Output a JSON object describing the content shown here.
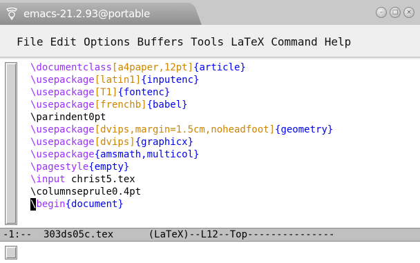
{
  "window": {
    "title": "emacs-21.2.93@portable",
    "buttons": [
      {
        "name": "minimize",
        "glyph": "–"
      },
      {
        "name": "maximize",
        "glyph": "□"
      },
      {
        "name": "close",
        "glyph": "×"
      }
    ]
  },
  "menu": {
    "items": [
      "File",
      "Edit",
      "Options",
      "Buffers",
      "Tools",
      "LaTeX",
      "Command",
      "Help"
    ]
  },
  "colors": {
    "keyword": "#9b30ff",
    "option": "#cd8500",
    "argument": "#0000ee"
  },
  "editor": {
    "lines": [
      [
        {
          "t": "\\documentclass",
          "c": "kw"
        },
        {
          "t": "[a4paper,12pt]",
          "c": "opt"
        },
        {
          "t": "{article}",
          "c": "arg"
        }
      ],
      [
        {
          "t": "\\usepackage",
          "c": "kw"
        },
        {
          "t": "[latin1]",
          "c": "opt"
        },
        {
          "t": "{inputenc}",
          "c": "arg"
        }
      ],
      [
        {
          "t": "\\usepackage",
          "c": "kw"
        },
        {
          "t": "[T1]",
          "c": "opt"
        },
        {
          "t": "{fontenc}",
          "c": "arg"
        }
      ],
      [
        {
          "t": "\\usepackage",
          "c": "kw"
        },
        {
          "t": "[frenchb]",
          "c": "opt"
        },
        {
          "t": "{babel}",
          "c": "arg"
        }
      ],
      [
        {
          "t": "\\parindent",
          "c": "plain"
        },
        {
          "t": "0pt",
          "c": "plain"
        }
      ],
      [
        {
          "t": "\\usepackage",
          "c": "kw"
        },
        {
          "t": "[dvips,margin=1.5cm,noheadfoot]",
          "c": "opt"
        },
        {
          "t": "{geometry}",
          "c": "arg"
        }
      ],
      [
        {
          "t": "\\usepackage",
          "c": "kw"
        },
        {
          "t": "[dvips]",
          "c": "opt"
        },
        {
          "t": "{graphicx}",
          "c": "arg"
        }
      ],
      [
        {
          "t": "\\usepackage",
          "c": "kw"
        },
        {
          "t": "{amsmath,multicol}",
          "c": "arg"
        }
      ],
      [
        {
          "t": "\\pagestyle",
          "c": "kw"
        },
        {
          "t": "{empty}",
          "c": "arg"
        }
      ],
      [
        {
          "t": "\\input",
          "c": "kw"
        },
        {
          "t": " christ5.tex",
          "c": "plain"
        }
      ],
      [
        {
          "t": "\\columnseprule",
          "c": "plain"
        },
        {
          "t": "0.4pt",
          "c": "plain"
        }
      ],
      [
        {
          "t": "\\",
          "c": "cursor"
        },
        {
          "t": "begin",
          "c": "kw"
        },
        {
          "t": "{document}",
          "c": "arg"
        }
      ]
    ]
  },
  "modeline": {
    "text": "-1:--  303ds05c.tex      (LaTeX)--L12--Top---------------"
  }
}
